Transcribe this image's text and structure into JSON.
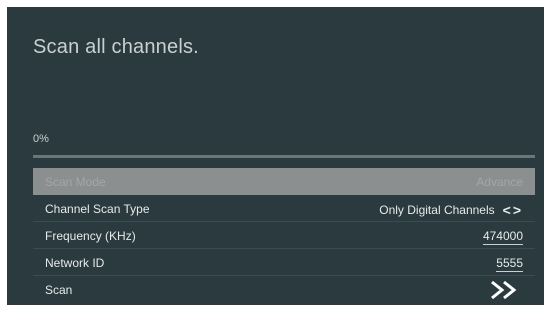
{
  "screen": {
    "title": "Scan all channels.",
    "progress": {
      "label": "0%",
      "fraction": 0
    }
  },
  "menu": {
    "scan_mode": {
      "label": "Scan Mode",
      "value": "Advance"
    },
    "channel_scan_type": {
      "label": "Channel Scan Type",
      "value": "Only Digital Channels",
      "arrows": "<>"
    },
    "frequency": {
      "label": "Frequency (KHz)",
      "value": "474000"
    },
    "network_id": {
      "label": "Network ID",
      "value": "5555"
    },
    "scan": {
      "label": "Scan",
      "icon": "double-chevron-right-icon"
    }
  }
}
